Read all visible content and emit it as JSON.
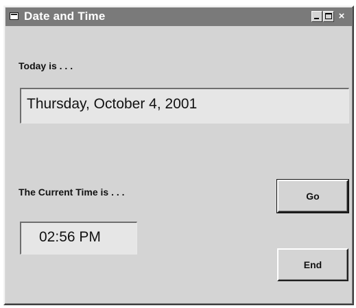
{
  "window": {
    "title": "Date and Time",
    "controls": {
      "minimize": "minimize",
      "maximize": "maximize",
      "close": "×"
    }
  },
  "labels": {
    "today": "Today is . . .",
    "current_time": "The Current Time is . . ."
  },
  "fields": {
    "date_value": "Thursday, October 4, 2001",
    "time_value": "02:56 PM"
  },
  "buttons": {
    "go": "Go",
    "end": "End"
  },
  "icons": {
    "system_menu": "window-icon",
    "minimize": "minimize-icon",
    "maximize": "maximize-icon",
    "close": "close-icon"
  },
  "colors": {
    "titlebar": "#7a7a7a",
    "face": "#d4d4d4",
    "textbox": "#e6e6e6"
  }
}
